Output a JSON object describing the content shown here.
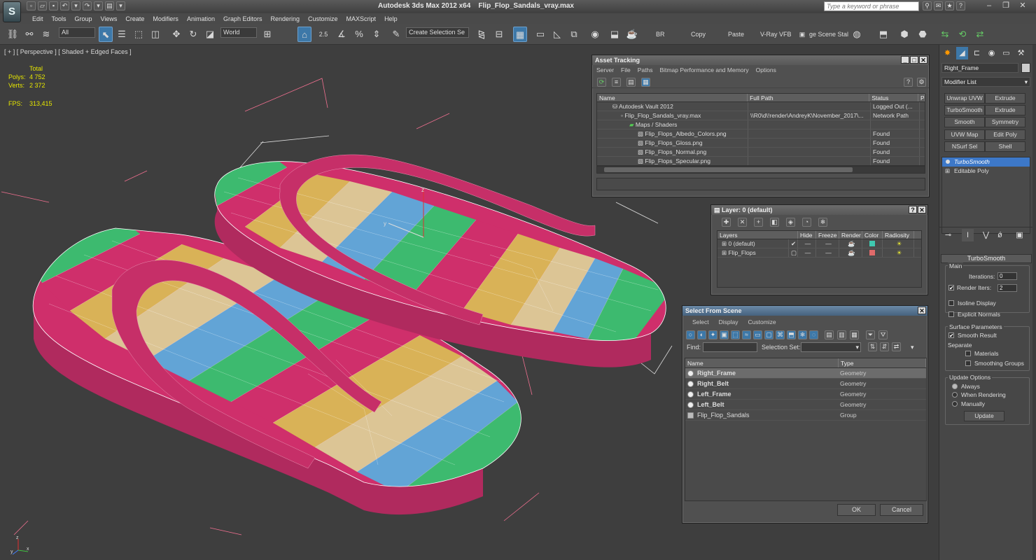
{
  "titlebar": {
    "app_name": "Autodesk 3ds Max  2012 x64",
    "file_name": "Flip_Flop_Sandals_vray.max",
    "search_placeholder": "Type a keyword or phrase",
    "logo_text": "S"
  },
  "menu": [
    "Edit",
    "Tools",
    "Group",
    "Views",
    "Create",
    "Modifiers",
    "Animation",
    "Graph Editors",
    "Rendering",
    "Customize",
    "MAXScript",
    "Help"
  ],
  "toolbar": {
    "filter": "All",
    "coord_system": "World",
    "snap_value": "2.5",
    "selection_set_placeholder": "Create Selection Se",
    "br_label": "BR",
    "copy_label": "Copy",
    "paste_label": "Paste",
    "vray_label": "V-Ray VFB",
    "scene_label": "ge Scene Stal"
  },
  "viewport": {
    "label": "[ + ] [ Perspective ] [ Shaded + Edged Faces ]",
    "stats_header": "Total",
    "polys_label": "Polys:",
    "polys_value": "4 752",
    "verts_label": "Verts:",
    "verts_value": "2 372",
    "fps_label": "FPS:",
    "fps_value": "313,415",
    "gizmo_z": "z",
    "gizmo_y": "y",
    "tripod_z": "z",
    "tripod_x": "x",
    "tripod_y": "y"
  },
  "asset_tracking": {
    "title": "Asset Tracking",
    "menu": [
      "Server",
      "File",
      "Paths",
      "Bitmap Performance and Memory",
      "Options"
    ],
    "columns": [
      "Name",
      "Full Path",
      "Status",
      "Pr"
    ],
    "rows": [
      {
        "name": "Autodesk Vault 2012",
        "path": "",
        "status": "Logged Out (..."
      },
      {
        "name": "Flip_Flop_Sandals_vray.max",
        "path": "\\\\R0\\d\\!render\\AndreyK\\November_2017\\...",
        "status": "Network Path"
      },
      {
        "name": "Maps / Shaders",
        "path": "",
        "status": ""
      },
      {
        "name": "Flip_Flops_Albedo_Colors.png",
        "path": "",
        "status": "Found"
      },
      {
        "name": "Flip_Flops_Gloss.png",
        "path": "",
        "status": "Found"
      },
      {
        "name": "Flip_Flops_Normal.png",
        "path": "",
        "status": "Found"
      },
      {
        "name": "Flip_Flops_Specular.png",
        "path": "",
        "status": "Found"
      }
    ]
  },
  "layers": {
    "title": "Layer: 0 (default)",
    "columns": [
      "Layers",
      "Hide",
      "Freeze",
      "Render",
      "Color",
      "Radiosity"
    ],
    "rows": [
      {
        "name": "0 (default)",
        "color": "#3fc8b0"
      },
      {
        "name": "Flip_Flops",
        "color": "#e06a6a"
      }
    ]
  },
  "select_from_scene": {
    "title": "Select From Scene",
    "menu": [
      "Select",
      "Display",
      "Customize"
    ],
    "find_label": "Find:",
    "selset_label": "Selection Set:",
    "columns": [
      "Name",
      "Type"
    ],
    "rows": [
      {
        "name": "Right_Frame",
        "type": "Geometry",
        "bold": true
      },
      {
        "name": "Right_Belt",
        "type": "Geometry",
        "bold": true
      },
      {
        "name": "Left_Frame",
        "type": "Geometry",
        "bold": true
      },
      {
        "name": "Left_Belt",
        "type": "Geometry",
        "bold": true
      },
      {
        "name": "Flip_Flop_Sandals",
        "type": "Group",
        "bold": false
      }
    ],
    "ok_label": "OK",
    "cancel_label": "Cancel"
  },
  "command_panel": {
    "object_name": "Right_Frame",
    "modifier_list": "Modifier List",
    "buttons": [
      "Unwrap UVW",
      "Extrude",
      "TurboSmooth",
      "Extrude",
      "Smooth",
      "Symmetry",
      "UVW Map",
      "Edit Poly",
      "NSurf Sel",
      "Shell"
    ],
    "stack": [
      "TurboSmooth",
      "Editable Poly"
    ],
    "rollout_title": "TurboSmooth",
    "main_label": "Main",
    "iterations_label": "Iterations:",
    "iterations_value": "0",
    "render_iters_label": "Render Iters:",
    "render_iters_value": "2",
    "isoline_label": "Isoline Display",
    "explicit_label": "Explicit Normals",
    "surface_label": "Surface Parameters",
    "smooth_result_label": "Smooth Result",
    "separate_label": "Separate",
    "materials_label": "Materials",
    "smoothing_groups_label": "Smoothing Groups",
    "update_options_label": "Update Options",
    "always_label": "Always",
    "when_rendering_label": "When Rendering",
    "manually_label": "Manually",
    "update_button": "Update"
  },
  "colors": {
    "pink": "#cf2f6b",
    "yellow": "#d9b257",
    "beige": "#dcc595",
    "blue": "#62a4d6",
    "green": "#3dba6f",
    "selection_blue": "#3d78c8"
  }
}
